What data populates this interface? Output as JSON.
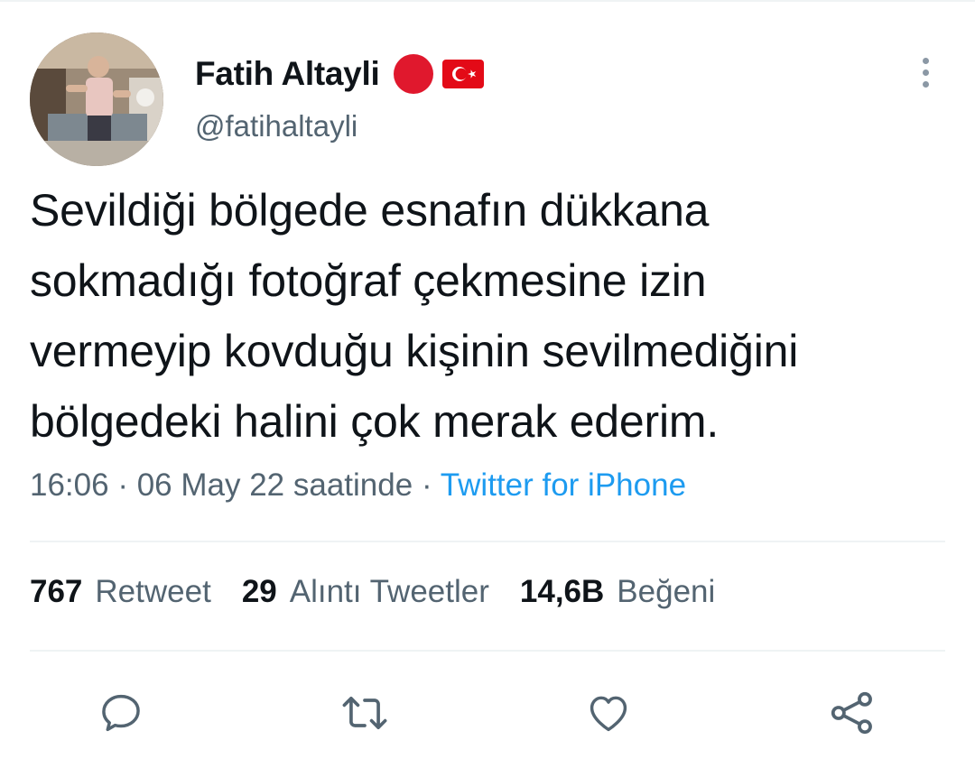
{
  "tweet": {
    "author": {
      "display_name": "Fatih Altayli",
      "handle": "@fatihaltayli",
      "avatar_icon": "profile-photo",
      "badges": [
        "red-circle-badge",
        "turkey-flag-badge"
      ]
    },
    "text_lines": [
      "Sevildiği bölgede esnafın dükkana",
      "sokmadığı fotoğraf çekmesine izin",
      "vermeyip kovduğu kişinin sevilmediğini",
      "bölgedeki halini çok merak ederim."
    ],
    "meta": {
      "time": "16:06",
      "separator": "·",
      "date": "06 May 22 saatinde",
      "source": "Twitter for iPhone"
    },
    "stats": [
      {
        "count": "767",
        "label": "Retweet"
      },
      {
        "count": "29",
        "label": "Alıntı Tweetler"
      },
      {
        "count": "14,6B",
        "label": "Beğeni"
      }
    ],
    "actions": [
      "reply-icon",
      "retweet-icon",
      "like-icon",
      "share-icon"
    ]
  },
  "colors": {
    "primary_text": "#0f1419",
    "secondary_text": "#536471",
    "link": "#1d9bf0",
    "divider": "#eff3f4",
    "badge_red": "#e0182d",
    "flag_red": "#e30a17"
  }
}
